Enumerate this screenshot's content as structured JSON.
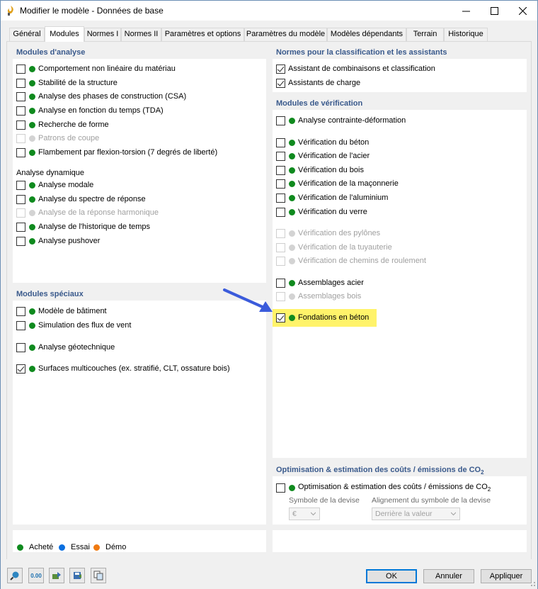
{
  "window": {
    "title": "Modifier le modèle - Données de base"
  },
  "tabs": [
    "Général",
    "Modules",
    "Normes I",
    "Normes II",
    "Paramètres et options",
    "Paramètres du modèle",
    "Modèles dépendants",
    "Terrain",
    "Historique"
  ],
  "active_tab": "Modules",
  "analysis": {
    "title": "Modules d'analyse",
    "items": [
      {
        "label": "Comportement non linéaire du matériau",
        "checked": false,
        "enabled": true
      },
      {
        "label": "Stabilité de la structure",
        "checked": false,
        "enabled": true
      },
      {
        "label": "Analyse des phases de construction (CSA)",
        "checked": false,
        "enabled": true
      },
      {
        "label": "Analyse en fonction du temps (TDA)",
        "checked": false,
        "enabled": true
      },
      {
        "label": "Recherche de forme",
        "checked": false,
        "enabled": true
      },
      {
        "label": "Patrons de coupe",
        "checked": false,
        "enabled": false
      },
      {
        "label": "Flambement par flexion-torsion (7 degrés de liberté)",
        "checked": false,
        "enabled": true
      }
    ],
    "dynamic_title": "Analyse dynamique",
    "dynamic_items": [
      {
        "label": "Analyse modale",
        "checked": false,
        "enabled": true
      },
      {
        "label": "Analyse du spectre de réponse",
        "checked": false,
        "enabled": true
      },
      {
        "label": "Analyse de la réponse harmonique",
        "checked": false,
        "enabled": false
      },
      {
        "label": "Analyse de l'historique de temps",
        "checked": false,
        "enabled": true
      },
      {
        "label": "Analyse pushover",
        "checked": false,
        "enabled": true
      }
    ]
  },
  "special": {
    "title": "Modules spéciaux",
    "items": [
      {
        "label": "Modèle de bâtiment",
        "checked": false,
        "enabled": true
      },
      {
        "label": "Simulation des flux de vent",
        "checked": false,
        "enabled": true
      },
      {
        "label": "Analyse géotechnique",
        "checked": false,
        "enabled": true
      },
      {
        "label": "Surfaces multicouches (ex. stratifié, CLT, ossature bois)",
        "checked": true,
        "enabled": true
      }
    ]
  },
  "norms": {
    "title": "Normes pour la classification et les assistants",
    "items": [
      {
        "label": "Assistant de combinaisons et classification",
        "checked": true
      },
      {
        "label": "Assistants de charge",
        "checked": true
      }
    ]
  },
  "verification": {
    "title": "Modules de vérification",
    "items": [
      {
        "label": "Analyse contrainte-déformation",
        "checked": false,
        "enabled": true
      },
      {
        "label": "Vérification du béton",
        "checked": false,
        "enabled": true
      },
      {
        "label": "Vérification de l'acier",
        "checked": false,
        "enabled": true
      },
      {
        "label": "Vérification du bois",
        "checked": false,
        "enabled": true
      },
      {
        "label": "Vérification de la maçonnerie",
        "checked": false,
        "enabled": true
      },
      {
        "label": "Vérification de l'aluminium",
        "checked": false,
        "enabled": true
      },
      {
        "label": "Vérification du verre",
        "checked": false,
        "enabled": true
      },
      {
        "label": "Vérification des pylônes",
        "checked": false,
        "enabled": false
      },
      {
        "label": "Vérification de la tuyauterie",
        "checked": false,
        "enabled": false
      },
      {
        "label": "Vérification de chemins de roulement",
        "checked": false,
        "enabled": false
      },
      {
        "label": "Assemblages acier",
        "checked": false,
        "enabled": true
      },
      {
        "label": "Assemblages bois",
        "checked": false,
        "enabled": false
      },
      {
        "label": "Fondations en béton",
        "checked": true,
        "enabled": true,
        "highlighted": true
      }
    ]
  },
  "optimization": {
    "title_main": "Optimisation & estimation des coûts / émissions de CO",
    "title_sub": "2",
    "label_main": "Optimisation & estimation des coûts / émissions de CO",
    "label_sub": "2",
    "checked": false,
    "currency_label": "Symbole de la devise",
    "currency_value": "€",
    "alignment_label": "Alignement du symbole de la devise",
    "alignment_value": "Derrière la valeur"
  },
  "legend": [
    {
      "label": "Acheté",
      "color": "#0f8a1e"
    },
    {
      "label": "Essai",
      "color": "#0a6fe0"
    },
    {
      "label": "Démo",
      "color": "#f07a12"
    }
  ],
  "buttons": {
    "ok": "OK",
    "cancel": "Annuler",
    "apply": "Appliquer"
  },
  "toolbar_icons": [
    "search-help-icon",
    "units-icon",
    "load-icon",
    "save-icon",
    "copy-icon"
  ],
  "toolbar_units_text": "0.00"
}
